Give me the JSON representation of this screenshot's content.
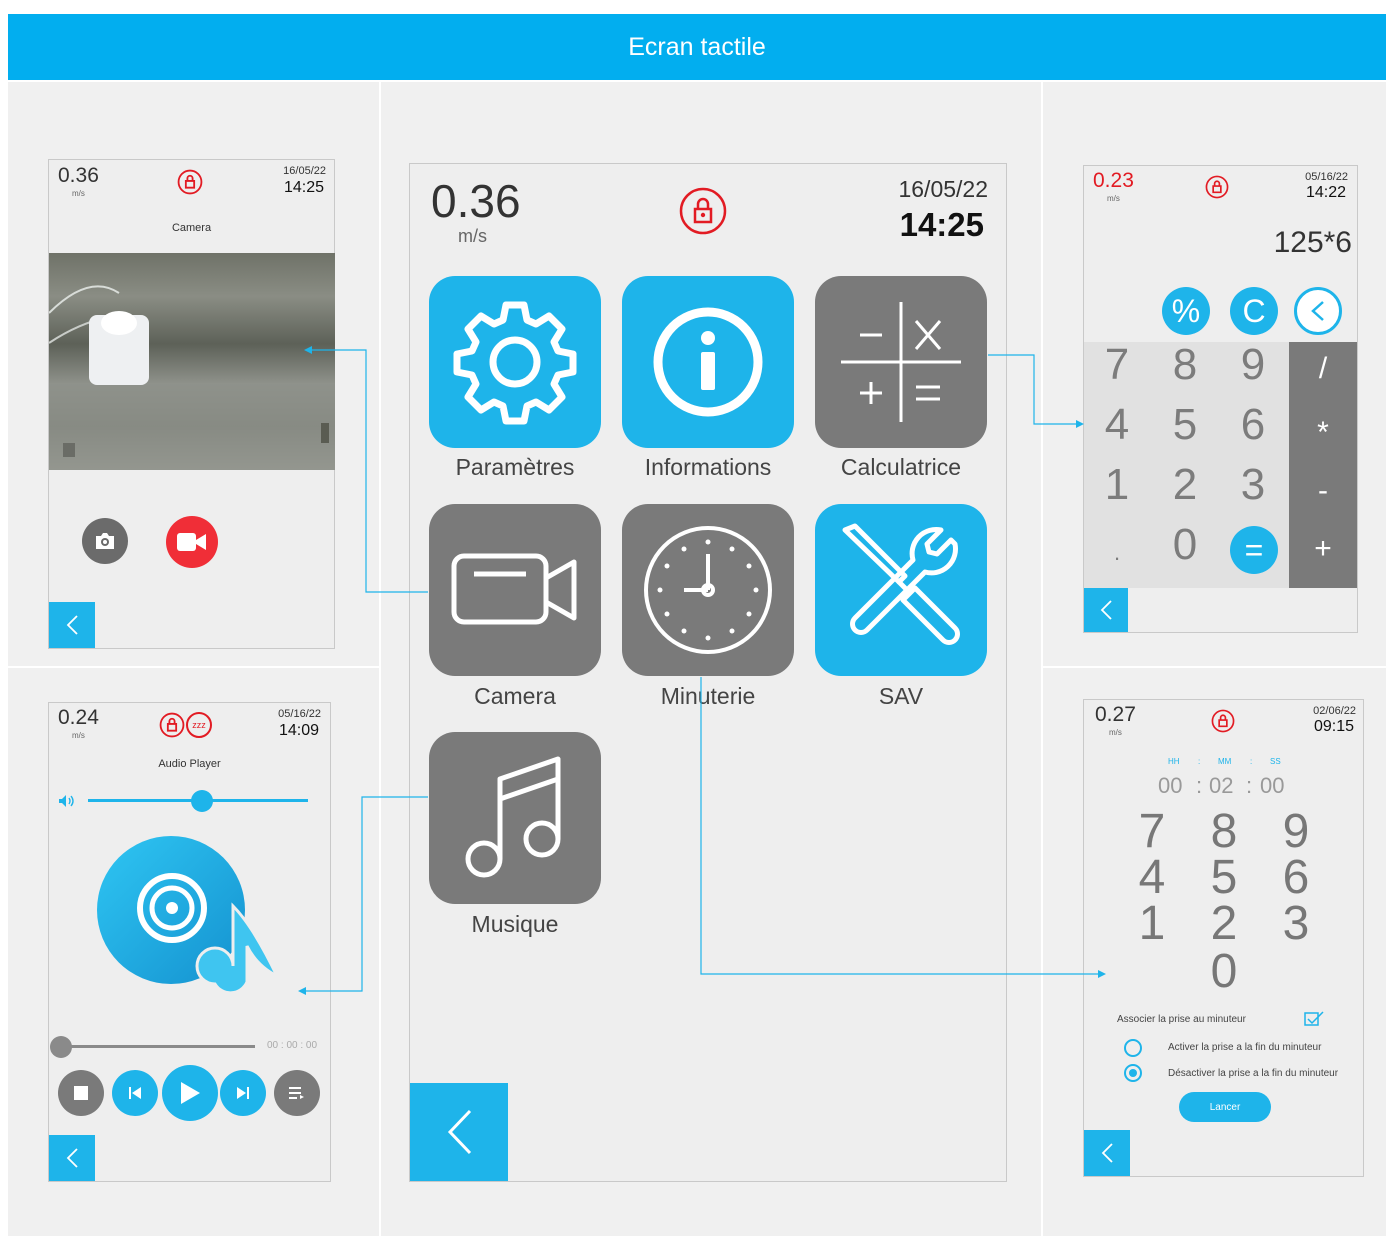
{
  "header": {
    "title": "Ecran tactile"
  },
  "colors": {
    "accent": "#1eb4ea",
    "header": "#02aeef",
    "tile_gray": "#7a7a7a",
    "lock_red": "#e21b23",
    "record_red": "#f02e37"
  },
  "main": {
    "speed": "0.36",
    "unit": "m/s",
    "date": "16/05/22",
    "time": "14:25",
    "tiles": [
      {
        "label": "Paramètres",
        "icon": "gear-icon"
      },
      {
        "label": "Informations",
        "icon": "info-icon"
      },
      {
        "label": "Calculatrice",
        "icon": "calculator-icon"
      },
      {
        "label": "Camera",
        "icon": "video-camera-icon"
      },
      {
        "label": "Minuterie",
        "icon": "clock-icon"
      },
      {
        "label": "SAV",
        "icon": "tools-icon"
      },
      {
        "label": "Musique",
        "icon": "music-note-icon"
      }
    ]
  },
  "camera": {
    "speed": "0.36",
    "unit": "m/s",
    "date": "16/05/22",
    "time": "14:25",
    "title": "Camera"
  },
  "audio": {
    "speed": "0.24",
    "unit": "m/s",
    "date": "05/16/22",
    "time": "14:09",
    "title": "Audio Player",
    "sleep": "zzz",
    "elapsed": "00 : 00 : 00",
    "volume": 0.52,
    "progress": 0.0
  },
  "calculator": {
    "speed": "0.23",
    "unit": "m/s",
    "date": "05/16/22",
    "time": "14:22",
    "display": "125*6",
    "top_keys": [
      "%",
      "C"
    ],
    "digits": [
      "7",
      "8",
      "9",
      "4",
      "5",
      "6",
      "1",
      "2",
      "3",
      ".",
      "0"
    ],
    "equals": "=",
    "ops": [
      "/",
      "*",
      "-",
      "+"
    ]
  },
  "timer": {
    "speed": "0.27",
    "unit": "m/s",
    "date": "02/06/22",
    "time": "09:15",
    "hh_label": "HH",
    "mm_label": "MM",
    "ss_label": "SS",
    "sep": ":",
    "hh": "00",
    "mm": "02",
    "ss": "00",
    "digits": [
      "7",
      "8",
      "9",
      "4",
      "5",
      "6",
      "1",
      "2",
      "3",
      "0"
    ],
    "associate_label": "Associer la prise au minuteur",
    "option_on": "Activer la prise a la fin du minuteur",
    "option_off": "Désactiver la prise a la fin du minuteur",
    "selected": "off",
    "launch": "Lancer"
  }
}
